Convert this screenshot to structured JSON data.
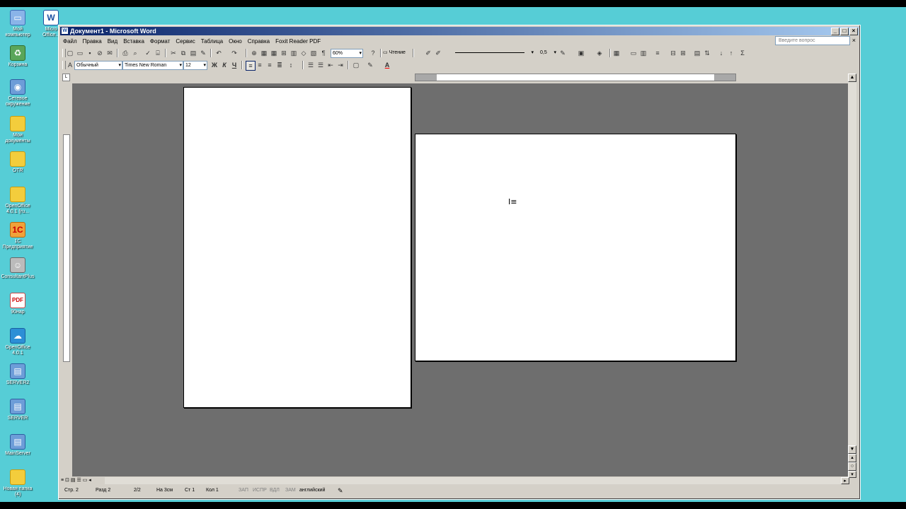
{
  "desktop": {
    "icons": [
      {
        "label": "Мой компьютер",
        "icon": "computer-icon"
      },
      {
        "label": "Корзина",
        "icon": "recycle-bin-icon"
      },
      {
        "label": "Сетевое окружение",
        "icon": "network-icon"
      },
      {
        "label": "Мои документы",
        "icon": "documents-folder-icon"
      },
      {
        "label": "OTR",
        "icon": "folder-icon"
      },
      {
        "label": "OpenOffice 4.0.1 (ru...",
        "icon": "folder-icon"
      },
      {
        "label": "1С Предприятие",
        "icon": "1c-icon"
      },
      {
        "label": "ConsultantPlus",
        "icon": "consultant-icon"
      },
      {
        "label": "90нар",
        "icon": "pdf-icon"
      },
      {
        "label": "OpenOffice 4.0.1",
        "icon": "openoffice-icon"
      },
      {
        "label": "SERVER2",
        "icon": "server-icon"
      },
      {
        "label": "SERVER",
        "icon": "server-icon"
      },
      {
        "label": "MainServer",
        "icon": "server-icon"
      },
      {
        "label": "Новая папка (4)",
        "icon": "folder-icon"
      }
    ],
    "top_icon": {
      "label": "Micro Office...",
      "icon": "word-icon"
    }
  },
  "window": {
    "title": "Документ1 - Microsoft Word",
    "menu": [
      "Файл",
      "Правка",
      "Вид",
      "Вставка",
      "Формат",
      "Сервис",
      "Таблица",
      "Окно",
      "Справка",
      "Foxit Reader PDF"
    ],
    "ask_placeholder": "Введите вопрос",
    "close_glyph": "×"
  },
  "toolbar": {
    "zoom": "60%",
    "reading": "Чтение",
    "line_weight": "0,5"
  },
  "formatting": {
    "style": "Обычный",
    "font": "Times New Roman",
    "size": "12",
    "bold": "Ж",
    "italic": "К",
    "underline": "Ч",
    "font_color_glyph": "A"
  },
  "status": {
    "page": "Стр. 2",
    "section": "Разд 2",
    "pages": "2/2",
    "position": "На 3см",
    "line": "Ст 1",
    "column": "Кол 1",
    "rec": "ЗАП",
    "trk": "ИСПР",
    "ext": "ВДЛ",
    "ovr": "ЗАМ",
    "language": "английский"
  }
}
